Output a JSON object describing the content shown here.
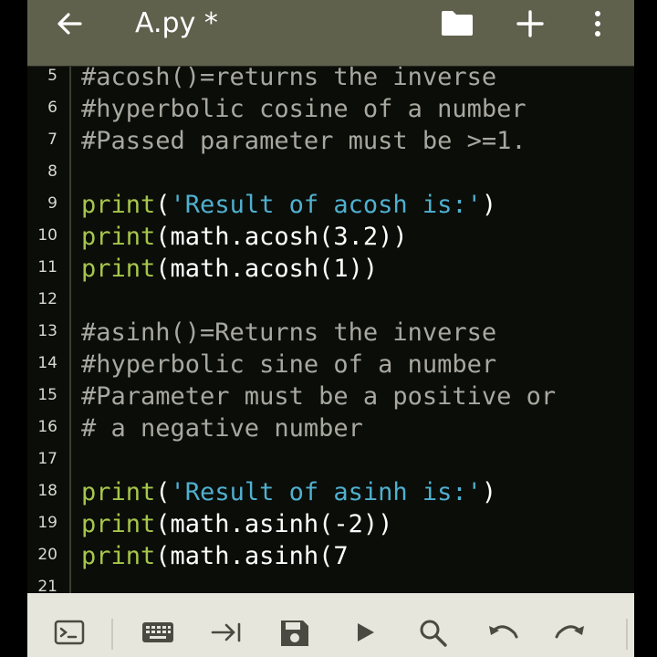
{
  "toolbar": {
    "title": "A.py *",
    "icons": [
      "back-arrow-icon",
      "folder-icon",
      "plus-icon",
      "more-vert-icon"
    ]
  },
  "editor": {
    "lines": [
      {
        "num": "5",
        "tokens": [
          {
            "t": "cmt",
            "text": "#acosh()=returns the inverse"
          }
        ]
      },
      {
        "num": "6",
        "tokens": [
          {
            "t": "cmt",
            "text": "#hyperbolic cosine of a number"
          }
        ]
      },
      {
        "num": "7",
        "tokens": [
          {
            "t": "cmt",
            "text": "#Passed parameter must be >=1."
          }
        ]
      },
      {
        "num": "8",
        "tokens": []
      },
      {
        "num": "9",
        "tokens": [
          {
            "t": "kw",
            "text": "print"
          },
          {
            "t": "plain",
            "text": "("
          },
          {
            "t": "str",
            "text": "'Result of acosh is:'"
          },
          {
            "t": "plain",
            "text": ")"
          }
        ]
      },
      {
        "num": "10",
        "tokens": [
          {
            "t": "kw",
            "text": "print"
          },
          {
            "t": "plain",
            "text": "(math.acosh(3.2))"
          }
        ]
      },
      {
        "num": "11",
        "tokens": [
          {
            "t": "kw",
            "text": "print"
          },
          {
            "t": "plain",
            "text": "(math.acosh(1))"
          }
        ]
      },
      {
        "num": "12",
        "tokens": []
      },
      {
        "num": "13",
        "tokens": [
          {
            "t": "cmt",
            "text": "#asinh()=Returns the inverse"
          }
        ]
      },
      {
        "num": "14",
        "tokens": [
          {
            "t": "cmt",
            "text": "#hyperbolic sine of a number"
          }
        ]
      },
      {
        "num": "15",
        "tokens": [
          {
            "t": "cmt",
            "text": "#Parameter must be a positive or"
          }
        ]
      },
      {
        "num": "16",
        "tokens": [
          {
            "t": "cmt",
            "text": "# a negative number"
          }
        ]
      },
      {
        "num": "17",
        "tokens": []
      },
      {
        "num": "18",
        "tokens": [
          {
            "t": "kw",
            "text": "print"
          },
          {
            "t": "plain",
            "text": "("
          },
          {
            "t": "str",
            "text": "'Result of asinh is:'"
          },
          {
            "t": "plain",
            "text": ")"
          }
        ]
      },
      {
        "num": "19",
        "tokens": [
          {
            "t": "kw",
            "text": "print"
          },
          {
            "t": "plain",
            "text": "(math.asinh(-2))"
          }
        ]
      },
      {
        "num": "20",
        "tokens": [
          {
            "t": "kw",
            "text": "print"
          },
          {
            "t": "plain",
            "text": "(math.asinh(7"
          }
        ]
      },
      {
        "num": "21",
        "tokens": []
      }
    ]
  },
  "bottombar": {
    "icons": [
      "terminal-icon",
      "keyboard-icon",
      "tab-icon",
      "save-icon",
      "run-icon",
      "search-icon",
      "undo-icon",
      "redo-icon"
    ]
  },
  "colors": {
    "toolbar": "#5f614c",
    "editor_bg": "#0b0d08",
    "keyword": "#a6c64c",
    "string": "#4fb0d0",
    "comment": "#a8a8a0",
    "bottombar": "#e6e6dc"
  }
}
